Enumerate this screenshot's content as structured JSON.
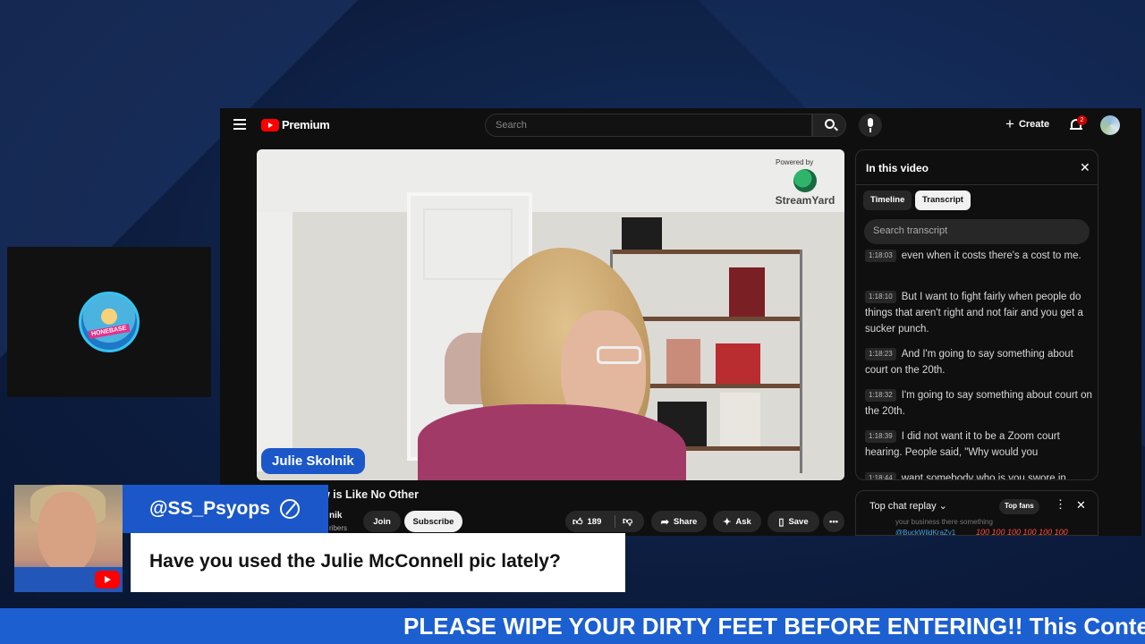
{
  "overlay": {
    "username": "@SS_Psyops",
    "message": "Have you used the Julie McConnell pic lately?",
    "ticker": "PLEASE WIPE YOUR DIRTY FEET BEFORE ENTERING!! This Content",
    "logo_text": "HONEBASE"
  },
  "youtube": {
    "brand": "Premium",
    "search_placeholder": "Search",
    "create_label": "Create",
    "notifications_count": "2",
    "video": {
      "powered_by": "Powered by",
      "streamyard": "StreamYard",
      "name_tag": "Julie Skolnik"
    },
    "title_partial": "ew is Like No Other",
    "channel_partial": "nik",
    "subs_partial": "ribers",
    "buttons": {
      "join": "Join",
      "subscribe": "Subscribe",
      "likes": "189",
      "share": "Share",
      "ask": "Ask",
      "save": "Save"
    },
    "panel": {
      "title": "In this video",
      "tabs": [
        "Timeline",
        "Transcript"
      ],
      "active_tab": "Transcript",
      "search_placeholder": "Search transcript",
      "segments": [
        {
          "time": "1:18:03",
          "text": "even when it costs there's a cost to me."
        },
        {
          "time": "1:18:10",
          "text": "But I want to fight fairly when people do things that aren't right and not fair and you get a sucker punch."
        },
        {
          "time": "1:18:23",
          "text": "And I'm going to say something about court on the 20th."
        },
        {
          "time": "1:18:32",
          "text": "I'm going to say something about court on the 20th."
        },
        {
          "time": "1:18:39",
          "text": "I did not want it to be a Zoom court hearing. People said, \"Why would you"
        },
        {
          "time": "1:18:44",
          "text": "want somebody who is you swore in"
        }
      ]
    },
    "chat": {
      "title": "Top chat replay",
      "filter": "Top fans",
      "faded_line": "your business there something",
      "author": "@BuckWildKraZy1",
      "message": "100 100 100 100 100 100"
    }
  }
}
